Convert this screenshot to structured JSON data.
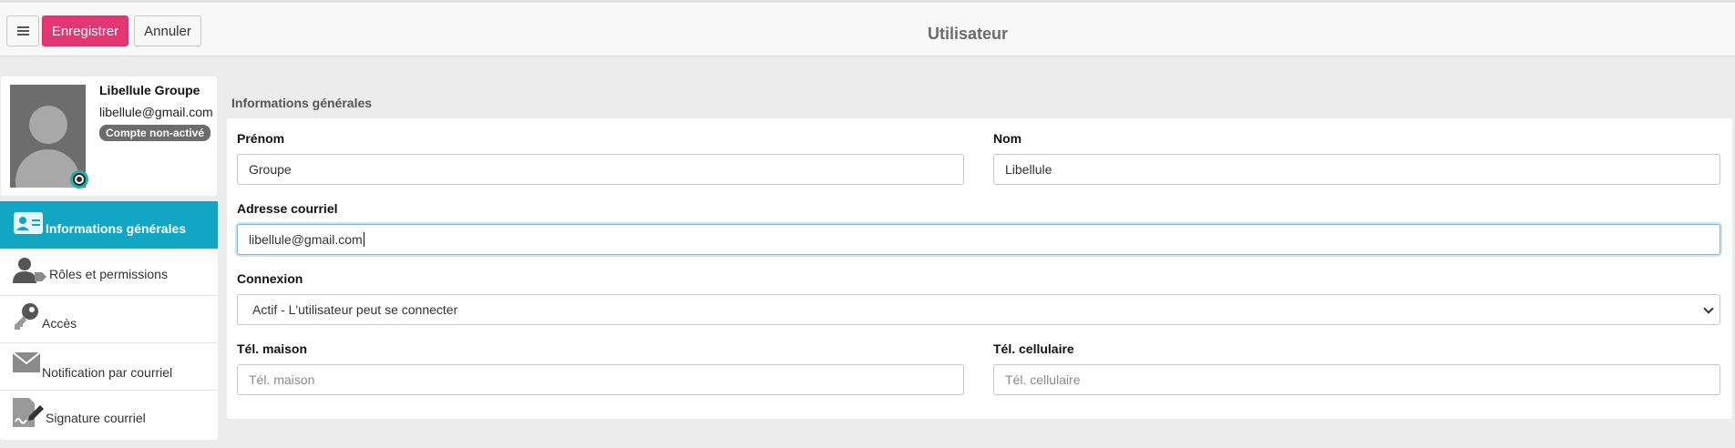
{
  "toolbar": {
    "save_label": "Enregistrer",
    "cancel_label": "Annuler",
    "title": "Utilisateur"
  },
  "profile": {
    "name": "Libellule Groupe",
    "email": "libellule@gmail.com",
    "badge": "Compte non-activé"
  },
  "nav": {
    "items": [
      {
        "label": "Informations générales",
        "icon": "id-card-icon",
        "active": true
      },
      {
        "label": "Rôles et permissions",
        "icon": "user-tag-icon",
        "active": false
      },
      {
        "label": "Accès",
        "icon": "key-icon",
        "active": false
      },
      {
        "label": "Notification par courriel",
        "icon": "envelope-icon",
        "active": false
      },
      {
        "label": "Signature courriel",
        "icon": "signature-icon",
        "active": false
      }
    ]
  },
  "form": {
    "section_title": "Informations générales",
    "prenom": {
      "label": "Prénom",
      "value": "Groupe"
    },
    "nom": {
      "label": "Nom",
      "value": "Libellule"
    },
    "email": {
      "label": "Adresse courriel",
      "value": "libellule@gmail.com"
    },
    "connexion": {
      "label": "Connexion",
      "value": "Actif - L'utilisateur peut se connecter"
    },
    "tel_maison": {
      "label": "Tél. maison",
      "placeholder": "Tél. maison"
    },
    "tel_cellulaire": {
      "label": "Tél. cellulaire",
      "placeholder": "Tél. cellulaire"
    }
  },
  "colors": {
    "accent_pink": "#e33774",
    "nav_active": "#12a6c5",
    "badge": "#6c6c6c"
  }
}
